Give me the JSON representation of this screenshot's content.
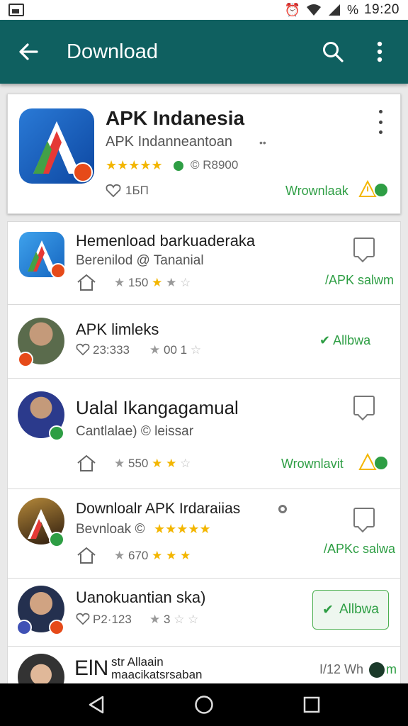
{
  "status_bar": {
    "time": "19:20",
    "battery": "%",
    "icons": [
      "gallery-icon",
      "alarm-icon",
      "wifi-icon",
      "signal-icon"
    ]
  },
  "app_bar": {
    "title": "Download",
    "back_icon": "arrow-left-icon",
    "search_icon": "search-icon",
    "menu_icon": "more-vert-icon"
  },
  "featured": {
    "name": "APK Indanesia",
    "subtitle": "APK Indanneantoan",
    "rating_text": "★★★★★",
    "rating_prefix": "",
    "verified_count": "© R8900",
    "likes": "1БП",
    "download_link": "Wrownlaak"
  },
  "items": [
    {
      "title": "Hemenload barkuaderaka",
      "subtitle": "Berenilod @ Tananial",
      "stars_count": "150",
      "action_label": "/APK salwm"
    },
    {
      "title": "APK limleks",
      "likes": "23:333",
      "stars_count": "00 1",
      "action_label": "Allbwa"
    },
    {
      "title": "Ualal Ikangagamual",
      "subtitle": "Cantlalae) © leissar",
      "stars_count": "550",
      "action_label": "Wrownlavit"
    },
    {
      "title": "Downloalr APK Irdaraiias",
      "subtitle": "Bevnloak ©",
      "stars_count": "670",
      "action_label": "/APKc salwa"
    },
    {
      "title": "Uanokuantian ska)",
      "likes": "P2·123",
      "stars_count": "3",
      "action_label": "Allbwa"
    },
    {
      "title_big": "ElN",
      "title_a": "str Allaain",
      "title_b": "maacikatsrsaban",
      "action_label": "I/12 Wh",
      "action_suffix": "m"
    }
  ],
  "colors": {
    "app_bar": "#0f6060",
    "accent_green": "#2e9e44",
    "star": "#f3b600"
  }
}
